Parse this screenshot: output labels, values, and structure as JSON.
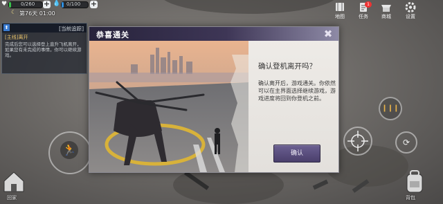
{
  "status": {
    "health": "0/260",
    "hunger": "0/100",
    "day_time": "第76天 01:00",
    "health_color": "#39c24a",
    "water_color": "#2e8fe0"
  },
  "quest": {
    "category": "[主线]离开",
    "tracking_label": "[当前追踪]",
    "description": "完成后您可以选择登上直升飞机离开，如果您有未完成的事情，你可以继续游戏。"
  },
  "top_menu": {
    "map": "地图",
    "tasks": "任务",
    "tasks_badge": "1",
    "mall": "商城",
    "settings": "设置"
  },
  "dialog": {
    "title": "恭喜通关",
    "question": "确认登机离开吗？",
    "description": "确认离开后，游戏通关。你依然可以在主界面选择继续游戏，游戏进度将回到你登机之前。",
    "confirm_label": "确认",
    "close_icon": "close-x-icon"
  },
  "controls": {
    "home_label": "回家",
    "backpack_label": "背包",
    "run_icon": "running-man-icon",
    "attack_icon": "crosshair-icon",
    "ammo_icon": "bullets-icon"
  }
}
